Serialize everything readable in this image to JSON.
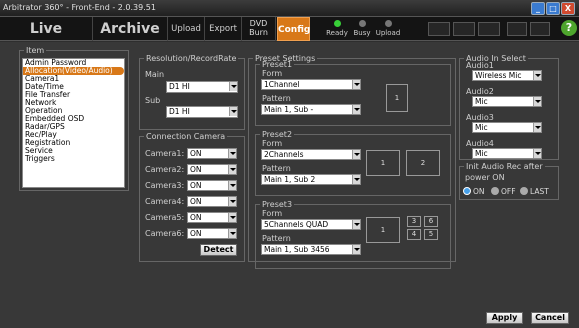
{
  "titlebar": {
    "title": "Arbitrator 360° - Front-End - 2.0.39.51"
  },
  "toolbar": {
    "live": "Live",
    "archive": "Archive",
    "upload": "Upload",
    "export": "Export",
    "dvd_burn_line1": "DVD",
    "dvd_burn_line2": "Burn",
    "config": "Config",
    "indicators": {
      "ready": "Ready",
      "busy": "Busy",
      "upload": "Upload"
    },
    "help": "?"
  },
  "item_panel": {
    "legend": "Item",
    "items": [
      "Admin Password",
      "Allocation(Video/Audio)",
      "Camera1",
      "Date/Time",
      "File Transfer",
      "Network",
      "Operation",
      "Embedded OSD",
      "Radar/GPS",
      "Rec/Play",
      "Registration",
      "Service",
      "Triggers"
    ],
    "selected_index": 1
  },
  "resolution": {
    "legend": "Resolution/RecordRate",
    "main_label": "Main",
    "main_value": "D1 HI",
    "sub_label": "Sub",
    "sub_value": "D1 HI"
  },
  "connection": {
    "legend": "Connection Camera",
    "cameras": [
      {
        "label": "Camera1:",
        "value": "ON"
      },
      {
        "label": "Camera2:",
        "value": "ON"
      },
      {
        "label": "Camera3:",
        "value": "ON"
      },
      {
        "label": "Camera4:",
        "value": "ON"
      },
      {
        "label": "Camera5:",
        "value": "ON"
      },
      {
        "label": "Camera6:",
        "value": "ON"
      }
    ],
    "detect": "Detect"
  },
  "preset": {
    "legend": "Preset Settings",
    "form_label": "Form",
    "pattern_label": "Pattern",
    "presets": [
      {
        "title": "Preset1",
        "form": "1Channel",
        "pattern": "Main 1, Sub -",
        "boxes": [
          "1"
        ]
      },
      {
        "title": "Preset2",
        "form": "2Channels",
        "pattern": "Main 1, Sub 2",
        "boxes": [
          "1",
          "2"
        ]
      },
      {
        "title": "Preset3",
        "form": "5Channels QUAD",
        "pattern": "Main 1, Sub 3456",
        "boxes": [
          "1",
          "3",
          "6",
          "4",
          "5"
        ]
      }
    ]
  },
  "audio": {
    "legend": "Audio In Select",
    "channels": [
      {
        "label": "Audio1",
        "value": "Wireless Mic"
      },
      {
        "label": "Audio2",
        "value": "Mic"
      },
      {
        "label": "Audio3",
        "value": "Mic"
      },
      {
        "label": "Audio4",
        "value": "Mic"
      }
    ]
  },
  "init_audio": {
    "legend_line1": "Init Audio Rec after",
    "legend_line2": "power ON",
    "options": [
      "ON",
      "OFF",
      "LAST"
    ],
    "selected": "ON"
  },
  "footer": {
    "apply": "Apply",
    "cancel": "Cancel"
  }
}
